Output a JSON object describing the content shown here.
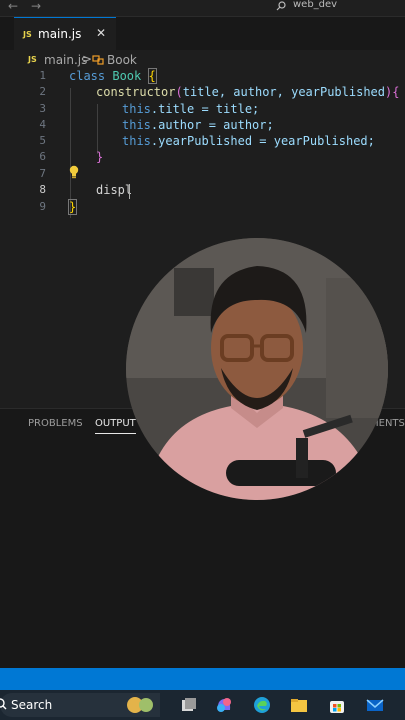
{
  "titlebar": {
    "back_glyph": "←",
    "forward_glyph": "→",
    "search_text": "web_dev"
  },
  "tab": {
    "lang_badge": "JS",
    "filename": "main.js",
    "close_glyph": "✕"
  },
  "breadcrumb": {
    "lang_badge": "JS",
    "file": "main.js",
    "separator": ">",
    "symbol": "Book"
  },
  "editor": {
    "line_numbers": [
      "1",
      "2",
      "3",
      "4",
      "5",
      "6",
      "7",
      "8",
      "9"
    ],
    "active_line": "8",
    "lines": {
      "l1": {
        "kw": "class",
        "name": "Book",
        "brace": "{"
      },
      "l2": {
        "fn": "constructor",
        "open": "(",
        "params": "title, author, yearPublished",
        "close": ")",
        "brace": "{"
      },
      "l3": {
        "this": "this",
        "rest": ".title = title;"
      },
      "l4": {
        "this": "this",
        "rest": ".author = author;"
      },
      "l5": {
        "this": "this",
        "rest": ".yearPublished = yearPublished;"
      },
      "l6": {
        "brace": "}"
      },
      "l8": {
        "text": "displ"
      },
      "l9": {
        "brace": "}"
      }
    }
  },
  "panel": {
    "tabs": [
      "PROBLEMS",
      "OUTPUT",
      "MENTS"
    ],
    "active_tab": "OUTPUT"
  },
  "taskbar": {
    "search_label": "Search"
  },
  "colors": {
    "accent": "#0078d4",
    "editor_bg": "#1e1e1e",
    "keyword": "#569cd6",
    "class_name": "#4ec9b0",
    "function": "#dcdcaa"
  },
  "icons": [
    "back-arrow-icon",
    "forward-arrow-icon",
    "search-icon",
    "close-icon",
    "class-symbol-icon",
    "lightbulb-icon",
    "windows-search-icon",
    "copilot-icon",
    "edge-icon",
    "file-explorer-icon",
    "store-icon",
    "mail-icon"
  ]
}
